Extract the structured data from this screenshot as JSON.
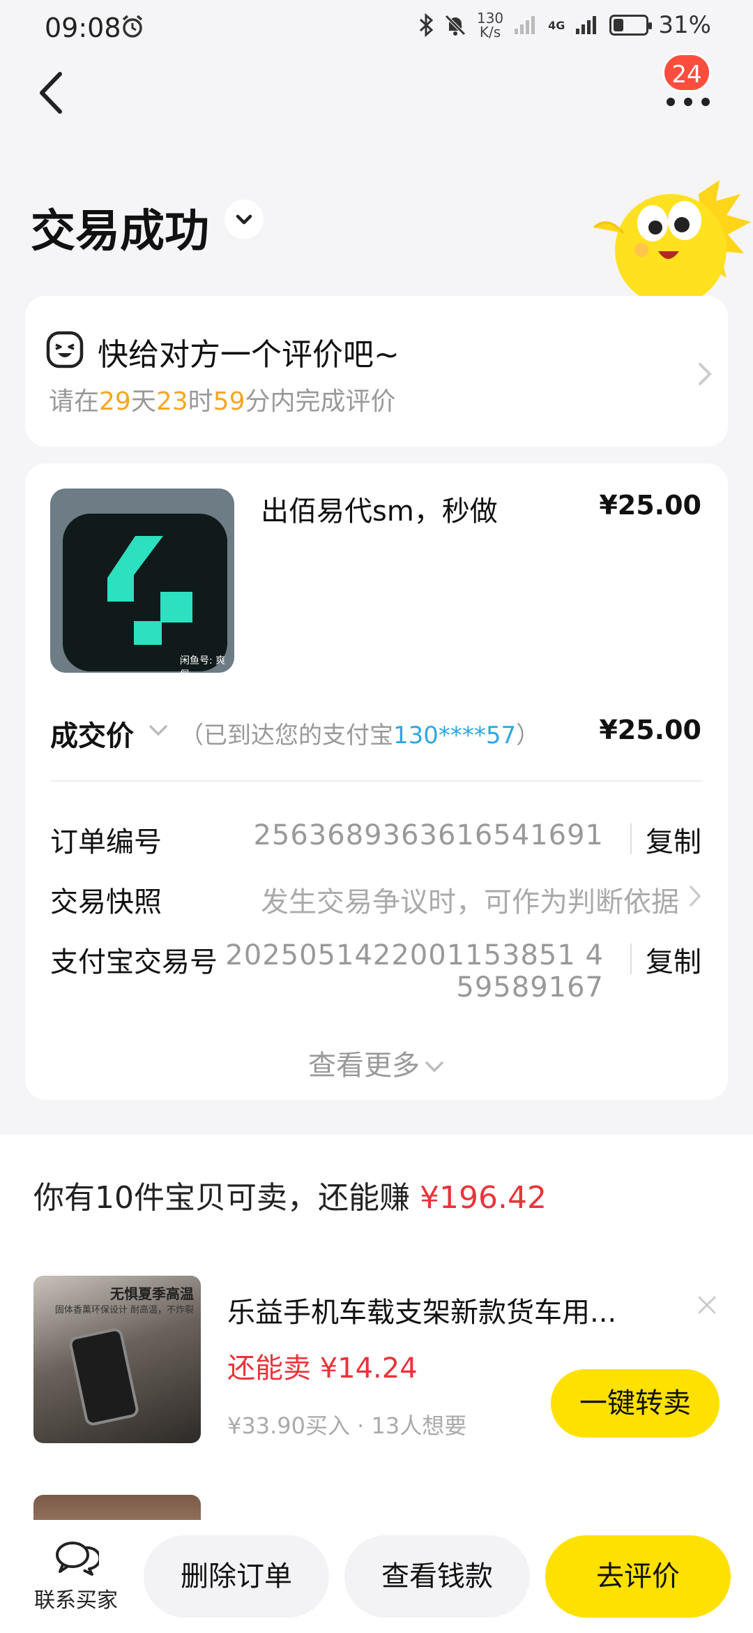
{
  "status_bar": {
    "time": "09:08",
    "net_speed_value": "130",
    "net_speed_unit": "K/s",
    "network": "4G",
    "battery": "31%",
    "battery_level": 0.31
  },
  "header": {
    "message_count": "24",
    "title": "交易成功"
  },
  "review": {
    "title": "快给对方一个评价吧~",
    "sub_prefix": "请在",
    "days": "29",
    "days_unit": "天",
    "hours": "23",
    "hours_unit": "时",
    "minutes": "59",
    "sub_suffix": "分内完成评价"
  },
  "order": {
    "thumb_watermark": "闲鱼号: 爽佩",
    "product_name": "出佰易代sm，秒做",
    "product_price": "¥25.00",
    "deal_label": "成交价",
    "deal_note_prefix": "（已到达您的支付宝",
    "deal_note_account": "130****57",
    "deal_note_suffix": "）",
    "deal_price": "¥25.00",
    "order_no_label": "订单编号",
    "order_no": "2563689363616541691",
    "copy_label": "复制",
    "snapshot_label": "交易快照",
    "snapshot_value": "发生交易争议时，可作为判断依据",
    "alipay_label": "支付宝交易号",
    "alipay_no_line1": "2025051422001153851 4",
    "alipay_no_line2": "59589167",
    "view_more": "查看更多"
  },
  "resell": {
    "title_prefix": "你有10件宝贝可卖，还能赚 ",
    "title_amount": "¥196.42",
    "item_tag": "无惧夏季高温",
    "item_tag_sub": "固体香薰环保设计 耐高温，不炸裂",
    "item_title": "乐益手机车载支架新款货车用...",
    "item_sell": "还能卖 ¥14.24",
    "item_meta": "¥33.90买入 · 13人想要",
    "resell_button": "一键转卖"
  },
  "bottom_bar": {
    "contact_label": "联系买家",
    "delete_order": "删除订单",
    "view_payment": "查看钱款",
    "go_review": "去评价"
  }
}
